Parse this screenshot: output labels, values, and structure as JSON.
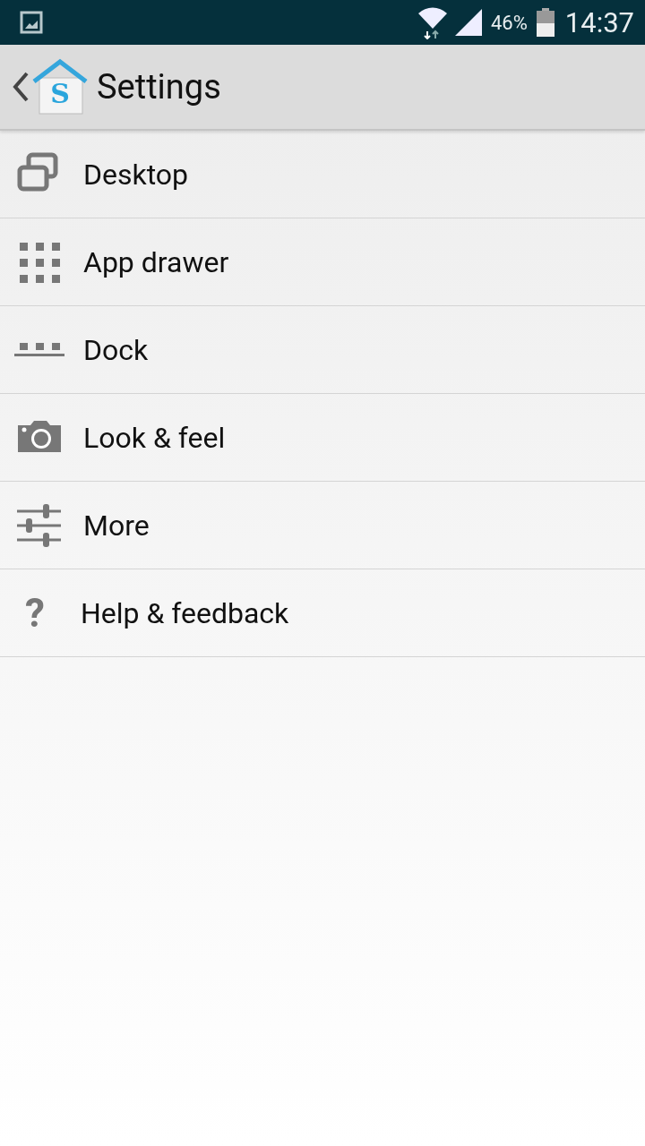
{
  "status_bar": {
    "battery": "46%",
    "time": "14:37"
  },
  "header": {
    "logo_letter": "S",
    "title": "Settings"
  },
  "items": [
    {
      "kind": "desktop",
      "label": "Desktop"
    },
    {
      "kind": "grid",
      "label": "App drawer"
    },
    {
      "kind": "dock",
      "label": "Dock"
    },
    {
      "kind": "camera",
      "label": "Look & feel"
    },
    {
      "kind": "sliders",
      "label": "More"
    },
    {
      "kind": "glyph",
      "icon": "?",
      "label": "Help & feedback"
    }
  ]
}
